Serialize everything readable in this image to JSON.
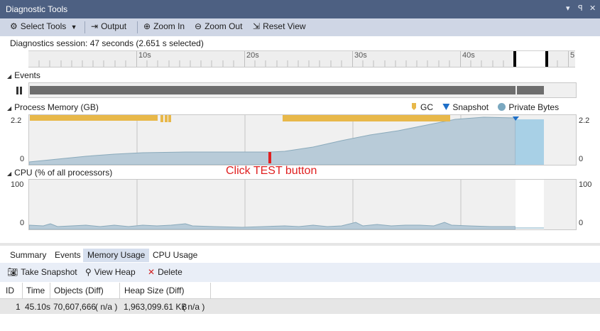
{
  "window": {
    "title": "Diagnostic Tools",
    "pin_glyph": "▾ ꟼ ✕"
  },
  "toolbar": {
    "select_tools": "Select Tools",
    "output": "Output",
    "zoom_in": "Zoom In",
    "zoom_out": "Zoom Out",
    "reset_view": "Reset View"
  },
  "session": {
    "text": "Diagnostics session: 47 seconds (2.651 s selected)"
  },
  "ruler": {
    "ticks": [
      "10s",
      "20s",
      "30s",
      "40s",
      "5"
    ]
  },
  "events": {
    "title": "Events"
  },
  "memory": {
    "title": "Process Memory (GB)",
    "legend": {
      "gc": "GC",
      "snapshot": "Snapshot",
      "private_bytes": "Private Bytes"
    },
    "axis_top": "2.2",
    "axis_bottom": "0",
    "annotation": "Click TEST button"
  },
  "cpu": {
    "title": "CPU (% of all processors)",
    "axis_top": "100",
    "axis_bottom": "0"
  },
  "tabs": [
    "Summary",
    "Events",
    "Memory Usage",
    "CPU Usage"
  ],
  "active_tab": "Memory Usage",
  "subtoolbar": {
    "take_snapshot": "Take Snapshot",
    "view_heap": "View Heap",
    "delete": "Delete"
  },
  "table": {
    "columns": [
      "ID",
      "Time",
      "Objects (Diff)",
      "Heap Size (Diff)"
    ],
    "rows": [
      {
        "id": "1",
        "time": "45.10s",
        "objects": "70,607,666",
        "objects_diff": "( n/a )",
        "heap": "1,963,099.61 KB",
        "heap_diff": "( n/a )"
      }
    ]
  },
  "colors": {
    "title_bg": "#4d6082",
    "toolbar_bg": "#cfd6e5",
    "gc": "#e8b84a",
    "snapshot": "#1e6fc8",
    "private_bytes": "#7aa8c0",
    "annotation": "#e02020",
    "selection": "#a8d0e6"
  }
}
